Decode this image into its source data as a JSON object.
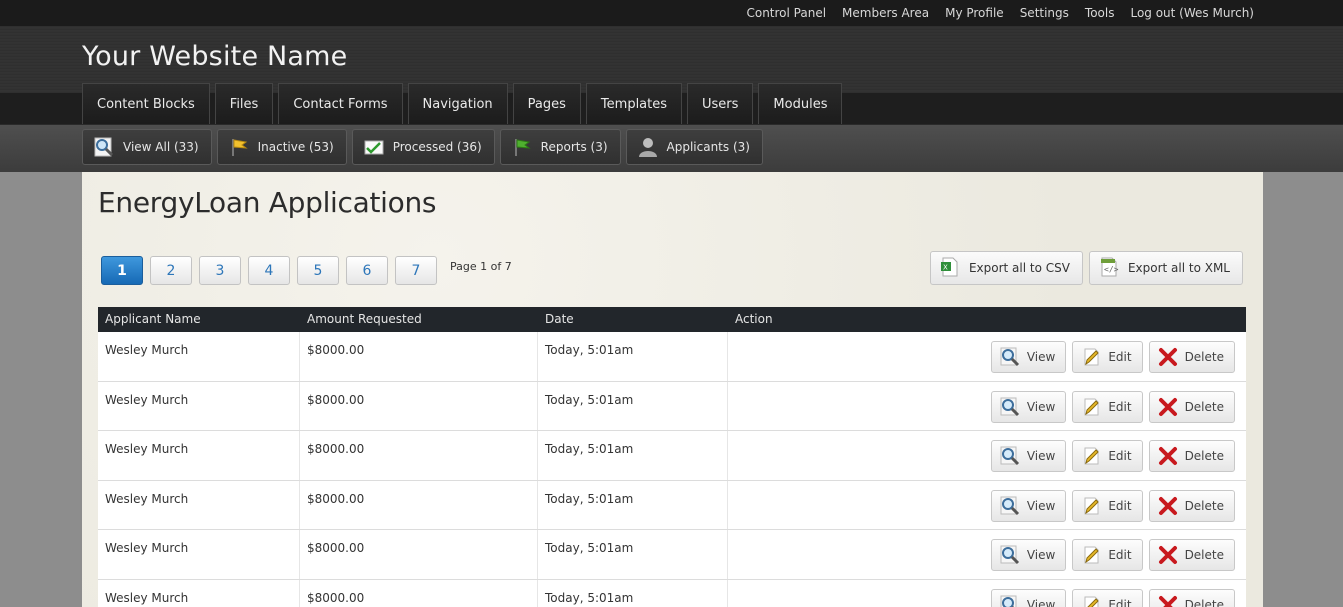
{
  "top_links": [
    "Control Panel",
    "Members Area",
    "My Profile",
    "Settings",
    "Tools",
    "Log out (Wes Murch)"
  ],
  "site_title": "Your Website Name",
  "main_tabs": [
    "Content Blocks",
    "Files",
    "Contact Forms",
    "Navigation",
    "Pages",
    "Templates",
    "Users",
    "Modules"
  ],
  "sub_tabs": [
    {
      "label": "View All (33)",
      "icon": "magnifier-icon"
    },
    {
      "label": "Inactive (53)",
      "icon": "yellow-flag-icon"
    },
    {
      "label": "Processed (36)",
      "icon": "checked-document-icon"
    },
    {
      "label": "Reports (3)",
      "icon": "green-flag-icon"
    },
    {
      "label": "Applicants (3)",
      "icon": "user-silhouette-icon"
    }
  ],
  "page_heading": "EnergyLoan Applications",
  "pagination": {
    "pages": [
      "1",
      "2",
      "3",
      "4",
      "5",
      "6",
      "7"
    ],
    "current": "1",
    "info": "Page 1 of 7"
  },
  "export": {
    "csv_label": "Export all to CSV",
    "xml_label": "Export all to XML"
  },
  "table": {
    "columns": [
      "Applicant Name",
      "Amount Requested",
      "Date",
      "Action"
    ],
    "rows": [
      {
        "name": "Wesley Murch",
        "amount": "$8000.00",
        "date": "Today, 5:01am"
      },
      {
        "name": "Wesley Murch",
        "amount": "$8000.00",
        "date": "Today, 5:01am"
      },
      {
        "name": "Wesley Murch",
        "amount": "$8000.00",
        "date": "Today, 5:01am"
      },
      {
        "name": "Wesley Murch",
        "amount": "$8000.00",
        "date": "Today, 5:01am"
      },
      {
        "name": "Wesley Murch",
        "amount": "$8000.00",
        "date": "Today, 5:01am"
      },
      {
        "name": "Wesley Murch",
        "amount": "$8000.00",
        "date": "Today, 5:01am"
      }
    ],
    "actions": {
      "view": "View",
      "edit": "Edit",
      "delete": "Delete"
    }
  },
  "colors": {
    "accent": "#1669b5",
    "header_bg": "#22262b",
    "delete_red": "#c8191e"
  }
}
